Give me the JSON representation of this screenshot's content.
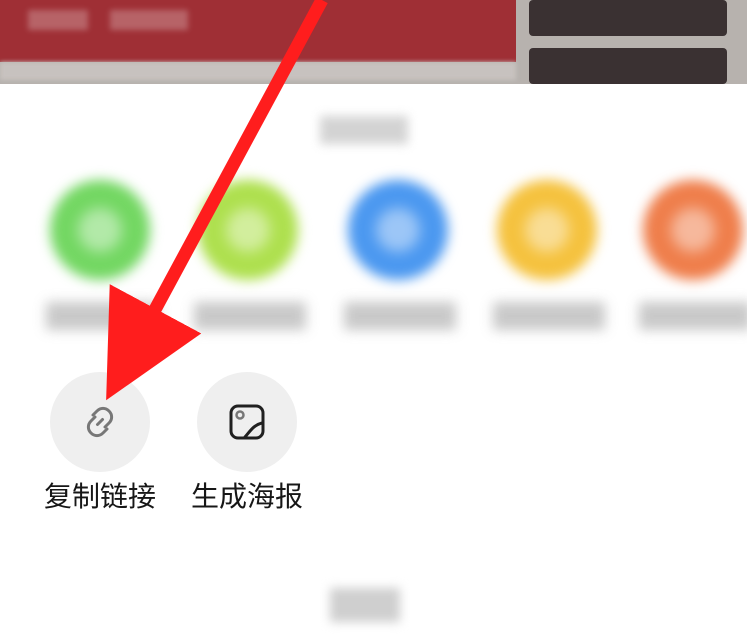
{
  "screen": {
    "background": "#ffffff"
  },
  "share_sheet": {
    "title": "",
    "targets": [
      {
        "name": "wechat-friend",
        "color": "#73d762",
        "label": ""
      },
      {
        "name": "moments",
        "color": "#aee04e",
        "label": ""
      },
      {
        "name": "qq-friend",
        "color": "#4b98f0",
        "label": ""
      },
      {
        "name": "qq-zone",
        "color": "#f5c23e",
        "label": ""
      },
      {
        "name": "weibo",
        "color": "#ef7e4b",
        "label": ""
      }
    ],
    "actions": [
      {
        "name": "copy-link",
        "label": "复制链接",
        "icon": "link-icon"
      },
      {
        "name": "generate-poster",
        "label": "生成海报",
        "icon": "image-icon"
      }
    ],
    "cancel_label": ""
  },
  "annotation": {
    "arrow_color": "#ff1d1d"
  }
}
